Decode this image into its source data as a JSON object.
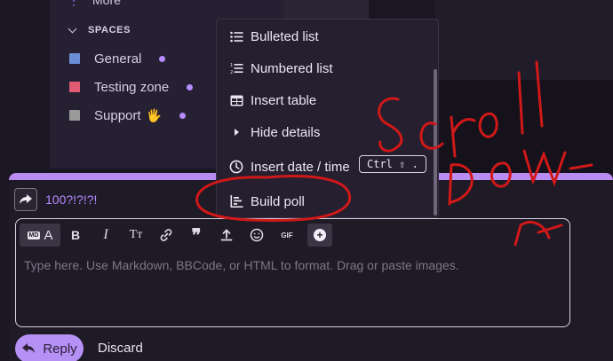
{
  "sidebar": {
    "more_label": "More",
    "spaces_header": "SPACES",
    "items": [
      {
        "label": "General",
        "color": "#6b8fd6"
      },
      {
        "label": "Testing zone",
        "color": "#e05a74"
      },
      {
        "label": "Support",
        "color": "#9a9a9a",
        "emoji": "🖐"
      }
    ]
  },
  "menu": {
    "items": [
      {
        "label": "Bulleted list",
        "icon": "bulleted-list-icon"
      },
      {
        "label": "Numbered list",
        "icon": "numbered-list-icon"
      },
      {
        "label": "Insert table",
        "icon": "table-icon"
      },
      {
        "label": "Hide details",
        "icon": "caret-right-icon"
      },
      {
        "label": "Insert date / time",
        "icon": "clock-icon",
        "shortcut": "Ctrl ⇧ ."
      },
      {
        "label": "Build poll",
        "icon": "poll-icon"
      }
    ]
  },
  "composer": {
    "topic_title": "100?!?!?!",
    "placeholder": "Type here. Use Markdown, BBCode, or HTML to format. Drag or paste images.",
    "reply_label": "Reply",
    "discard_label": "Discard",
    "toolbar": {
      "md_label": "MD",
      "a_label": "A",
      "bold": "B",
      "italic": "I",
      "heading": "Tт",
      "gif": "GIF",
      "plus": "+"
    }
  },
  "annotation": {
    "color": "#d01818",
    "text": "Scroll Down"
  },
  "colors": {
    "accent": "#b590f5",
    "menu_bg": "#251f2f",
    "page_bg": "#1a1622"
  }
}
